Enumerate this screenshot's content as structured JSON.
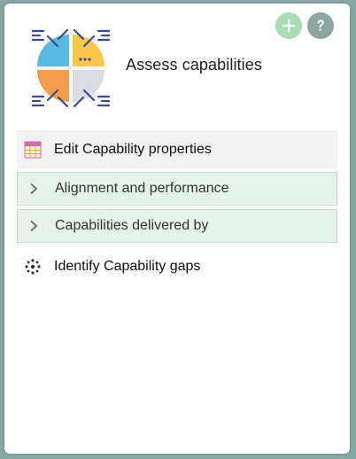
{
  "header": {
    "title": "Assess capabilities",
    "icon": "capability-quadrant-icon",
    "add_button_icon": "plus-icon",
    "help_button_icon": "question-mark-icon"
  },
  "menu": {
    "edit_properties": {
      "label": "Edit Capability properties",
      "icon": "table-grid-icon"
    },
    "sections": [
      {
        "label": "Alignment and performance",
        "icon": "chevron-right-icon"
      },
      {
        "label": "Capabilities delivered by",
        "icon": "chevron-right-icon"
      }
    ],
    "identify_gaps": {
      "label": "Identify Capability gaps",
      "icon": "scatter-dots-icon"
    }
  },
  "colors": {
    "background": "#8aa8a3",
    "add_button": "#a9dcb4",
    "help_button": "#8fa5a2",
    "section_bg": "#e6f2ea",
    "quadrant_blue": "#5bb8de",
    "quadrant_yellow": "#f7c64b",
    "quadrant_orange": "#f29d4b",
    "quadrant_grey": "#d9dde2",
    "accent_navy": "#3b4b8f"
  }
}
